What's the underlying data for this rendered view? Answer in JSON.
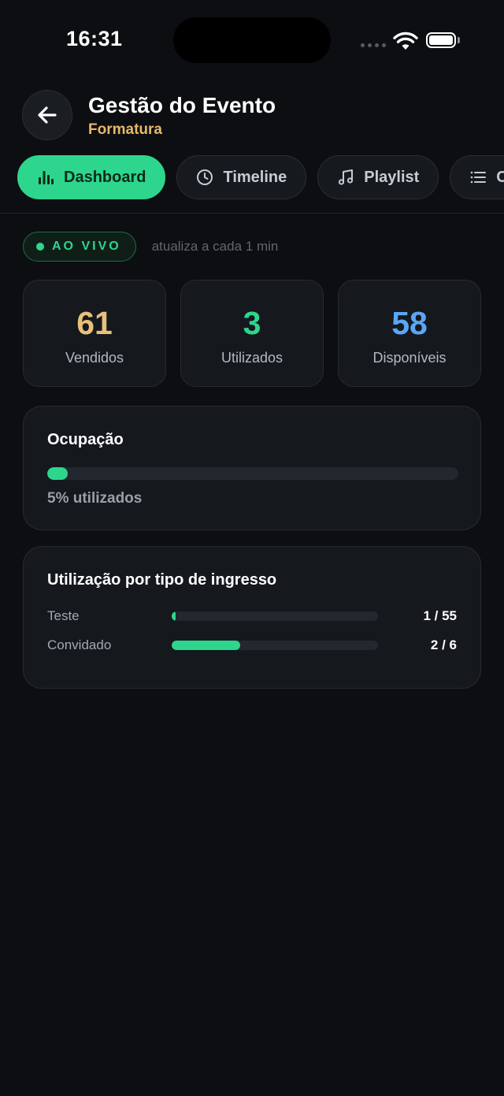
{
  "status": {
    "time": "16:31"
  },
  "header": {
    "title": "Gestão do Evento",
    "subtitle": "Formatura"
  },
  "tabs": [
    {
      "label": "Dashboard",
      "icon": "bar-chart-icon",
      "active": true
    },
    {
      "label": "Timeline",
      "icon": "clock-icon",
      "active": false
    },
    {
      "label": "Playlist",
      "icon": "music-note-icon",
      "active": false
    },
    {
      "label": "C",
      "icon": "list-icon",
      "active": false
    }
  ],
  "live": {
    "badge": "AO VIVO",
    "refresh": "atualiza a cada 1 min"
  },
  "stats": [
    {
      "value": "61",
      "label": "Vendidos",
      "color": "#e9c07a"
    },
    {
      "value": "3",
      "label": "Utilizados",
      "color": "#2dd68c"
    },
    {
      "value": "58",
      "label": "Disponíveis",
      "color": "#5aa6f5"
    }
  ],
  "occupancy": {
    "title": "Ocupação",
    "percent": 5,
    "text": "5% utilizados"
  },
  "by_type": {
    "title": "Utilização por tipo de ingresso",
    "rows": [
      {
        "label": "Teste",
        "used": 1,
        "total": 55,
        "value": "1 / 55"
      },
      {
        "label": "Convidado",
        "used": 2,
        "total": 6,
        "value": "2 / 6"
      }
    ]
  },
  "colors": {
    "accent": "#2dd68c",
    "background": "#0c0e12",
    "card": "#15181d",
    "subtitle": "#e7b868"
  }
}
